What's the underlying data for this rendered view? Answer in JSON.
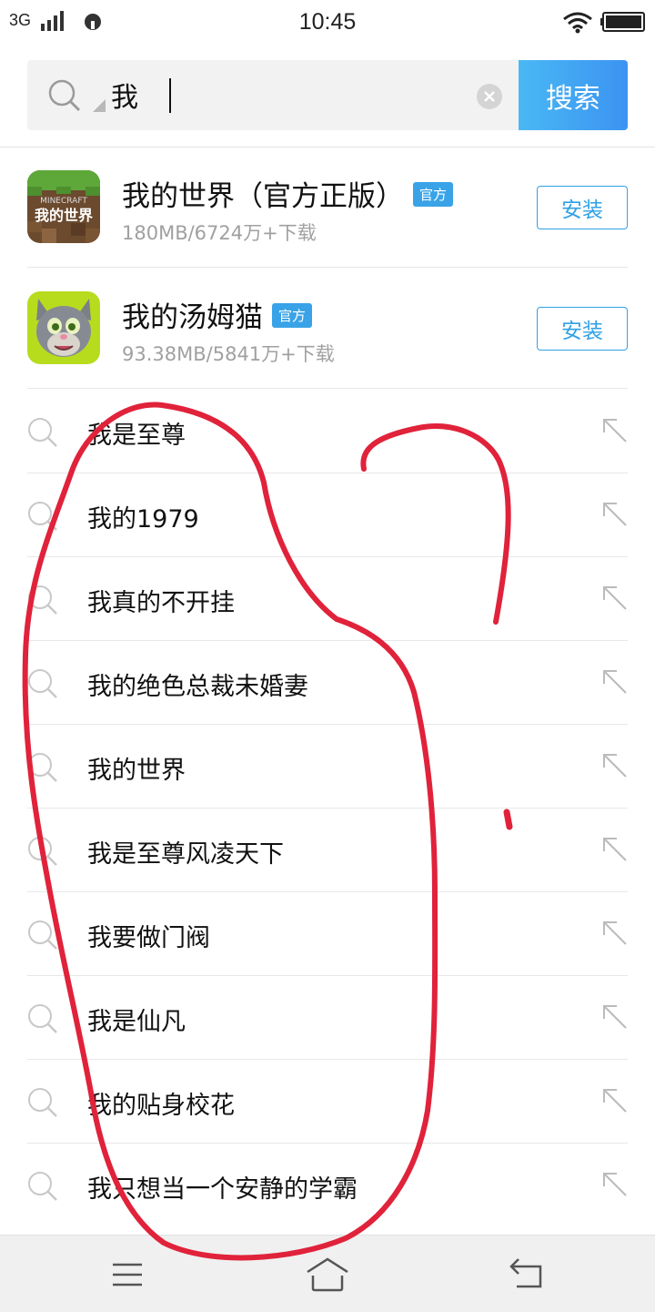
{
  "status_bar": {
    "network": "3G",
    "time": "10:45",
    "icons": [
      "signal-icon",
      "app-notification-icon",
      "wifi-icon",
      "battery-icon"
    ]
  },
  "search": {
    "query": "我",
    "button_label": "搜索",
    "icons": [
      "search-icon",
      "clear-icon"
    ]
  },
  "apps": [
    {
      "name": "我的世界（官方正版）",
      "badge": "官方",
      "meta": "180MB/6724万+下载",
      "install_label": "安装",
      "icon": "minecraft-app-icon",
      "icon_text": "MINECRAFT 我的世界"
    },
    {
      "name": "我的汤姆猫",
      "badge": "官方",
      "meta": "93.38MB/5841万+下载",
      "install_label": "安装",
      "icon": "talking-tom-app-icon"
    }
  ],
  "suggestions": [
    "我是至尊",
    "我的1979",
    "我真的不开挂",
    "我的绝色总裁未婚妻",
    "我的世界",
    "我是至尊风凌天下",
    "我要做门阀",
    "我是仙凡",
    "我的贴身校花",
    "我只想当一个安静的学霸"
  ],
  "nav": {
    "icons": [
      "menu-icon",
      "home-icon",
      "back-icon"
    ]
  },
  "colors": {
    "accent": "#2fa1e6",
    "search_button_start": "#4ab8f4",
    "search_button_end": "#3b93f2",
    "badge": "#3aa3e8",
    "annotation_ink": "#e0223a"
  }
}
